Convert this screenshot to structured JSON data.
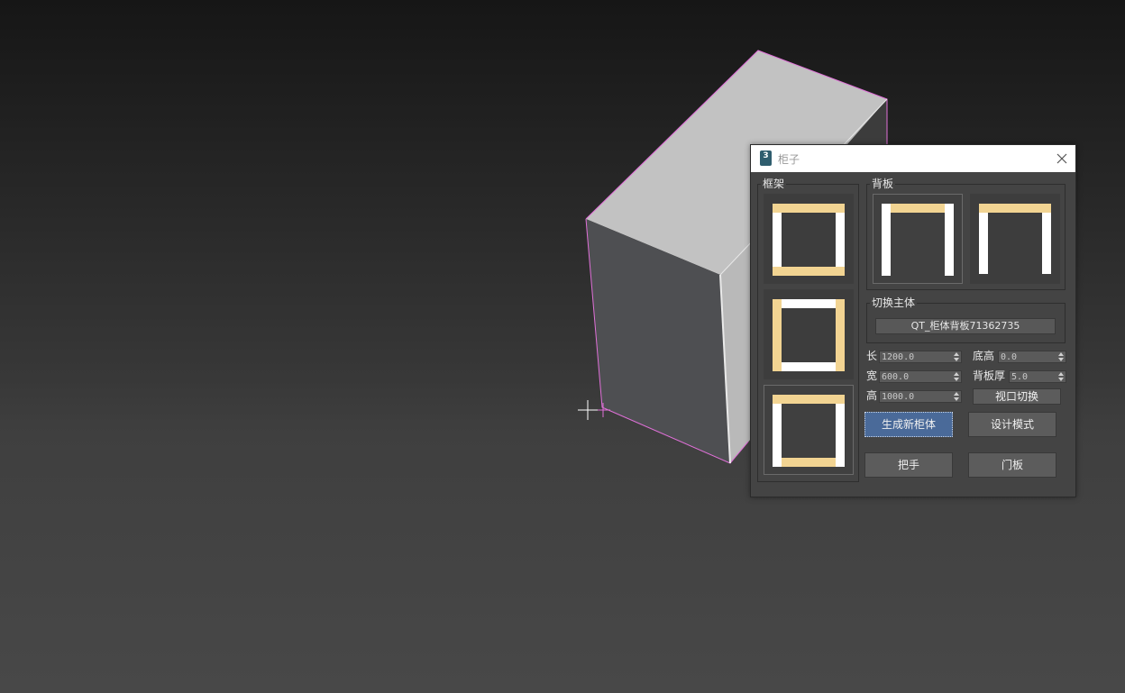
{
  "dialog": {
    "app_icon_text": "3",
    "title": "柜子",
    "frame_group_label": "框架",
    "back_group_label": "背板",
    "switch_group_label": "切换主体",
    "switch_object_name": "QT_柜体背板71362735",
    "fields": {
      "length_label": "长",
      "length_value": "1200.0",
      "width_label": "宽",
      "width_value": "600.0",
      "height_label": "高",
      "height_value": "1000.0",
      "base_height_label": "底高",
      "base_height_value": "0.0",
      "back_thickness_label": "背板厚",
      "back_thickness_value": "5.0"
    },
    "buttons": {
      "viewport_switch": "视口切换",
      "generate": "生成新柜体",
      "design_mode": "设计模式",
      "handle": "把手",
      "door": "门板"
    }
  },
  "colors": {
    "accent_yellow": "#f2d492",
    "panel_white": "#ffffff",
    "selection_pink": "#e070d8",
    "primary_button": "#4a6a99"
  }
}
